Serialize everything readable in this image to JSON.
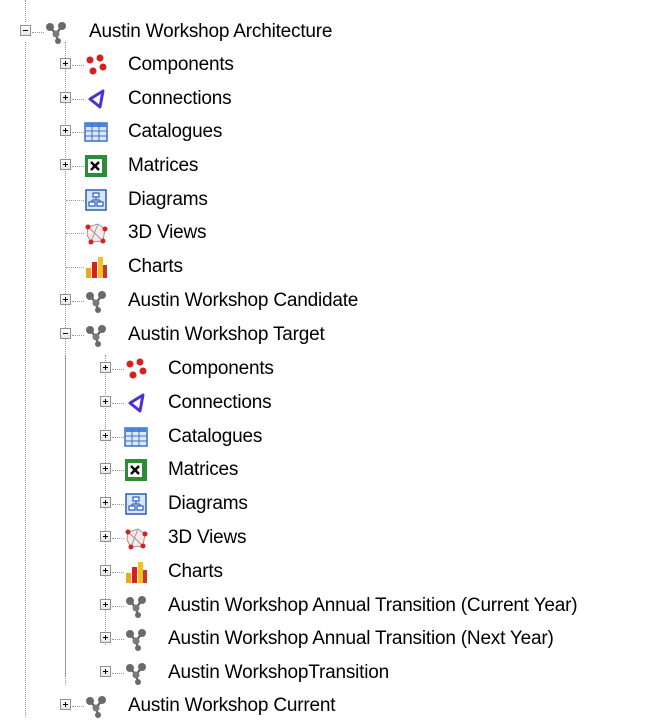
{
  "tree": {
    "root": {
      "label": "Austin Workshop Architecture",
      "children": [
        {
          "label": "Components",
          "icon": "components-icon"
        },
        {
          "label": "Connections",
          "icon": "connections-icon"
        },
        {
          "label": "Catalogues",
          "icon": "catalogues-icon"
        },
        {
          "label": "Matrices",
          "icon": "matrices-icon"
        },
        {
          "label": "Diagrams",
          "icon": "diagrams-icon"
        },
        {
          "label": "3D Views",
          "icon": "views-3d-icon"
        },
        {
          "label": "Charts",
          "icon": "charts-icon"
        },
        {
          "label": "Austin Workshop Candidate",
          "icon": "architecture-icon"
        },
        {
          "label": "Austin Workshop Target",
          "icon": "architecture-icon",
          "children": [
            {
              "label": "Components",
              "icon": "components-icon"
            },
            {
              "label": "Connections",
              "icon": "connections-icon"
            },
            {
              "label": "Catalogues",
              "icon": "catalogues-icon"
            },
            {
              "label": "Matrices",
              "icon": "matrices-icon"
            },
            {
              "label": "Diagrams",
              "icon": "diagrams-icon"
            },
            {
              "label": "3D Views",
              "icon": "views-3d-icon"
            },
            {
              "label": "Charts",
              "icon": "charts-icon"
            },
            {
              "label": "Austin Workshop Annual Transition (Current Year)",
              "icon": "architecture-icon"
            },
            {
              "label": "Austin Workshop Annual Transition (Next Year)",
              "icon": "architecture-icon"
            },
            {
              "label": "Austin WorkshopTransition",
              "icon": "architecture-icon"
            }
          ]
        },
        {
          "label": "Austin Workshop Current",
          "icon": "architecture-icon"
        }
      ]
    }
  }
}
